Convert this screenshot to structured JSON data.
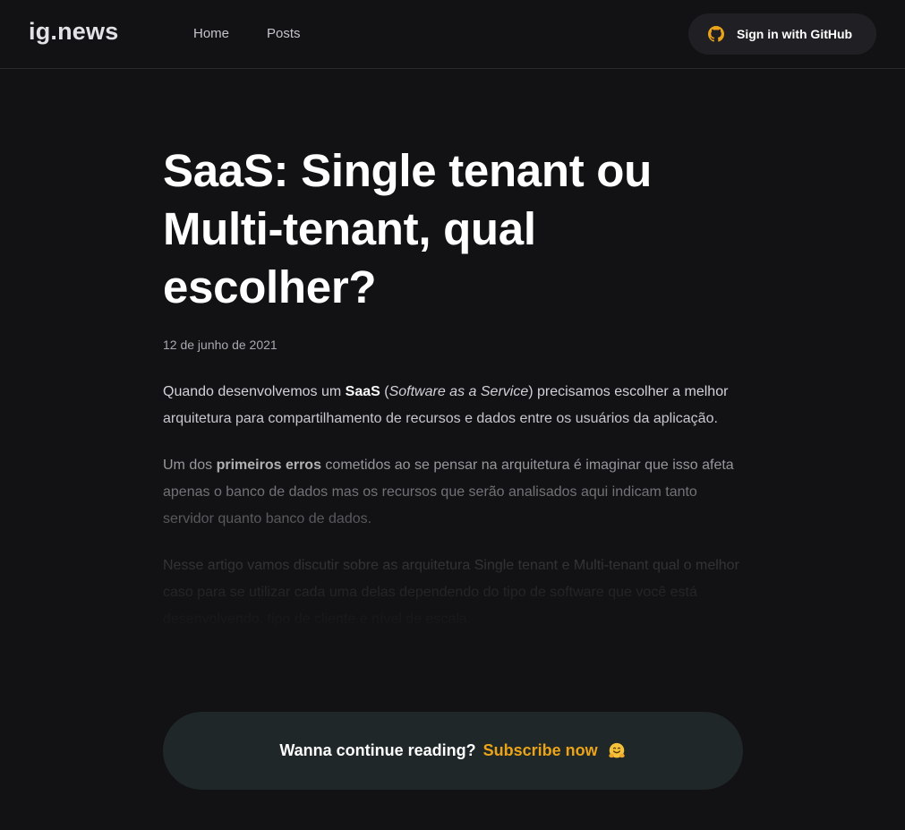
{
  "header": {
    "logo": "ig.news",
    "nav": [
      "Home",
      "Posts"
    ],
    "signin_label": "Sign in with GitHub",
    "signin_icon": "github-icon",
    "accent_color": "#eba417"
  },
  "post": {
    "title": "SaaS: Single tenant ou Multi-tenant, qual escolher?",
    "date": "12 de junho de 2021",
    "paragraphs": [
      {
        "p1_a": "Quando desenvolvemos um ",
        "p1_b": "SaaS",
        "p1_c": " (",
        "p1_d": "Software as a Service",
        "p1_e": ") precisamos escolher a melhor arquitetura para compartilhamento de recursos e dados entre os usuários da aplicação."
      },
      {
        "p2_a": "Um dos ",
        "p2_b": "primeiros erros",
        "p2_c": " cometidos ao se pensar na arquitetura é imaginar que isso afeta apenas o banco de dados mas os recursos que serão analisados aqui indicam tanto servidor quanto banco de dados."
      },
      {
        "p3": "Nesse artigo vamos discutir sobre as arquitetura Single tenant e Multi-tenant qual o melhor caso para se utilizar cada uma delas dependendo do tipo de software que você está desenvolvendo, tipo de cliente e nível de escala."
      }
    ]
  },
  "cta": {
    "lead": "Wanna continue reading?",
    "link": "Subscribe now",
    "icon": "hugging-face-emoji-icon"
  }
}
